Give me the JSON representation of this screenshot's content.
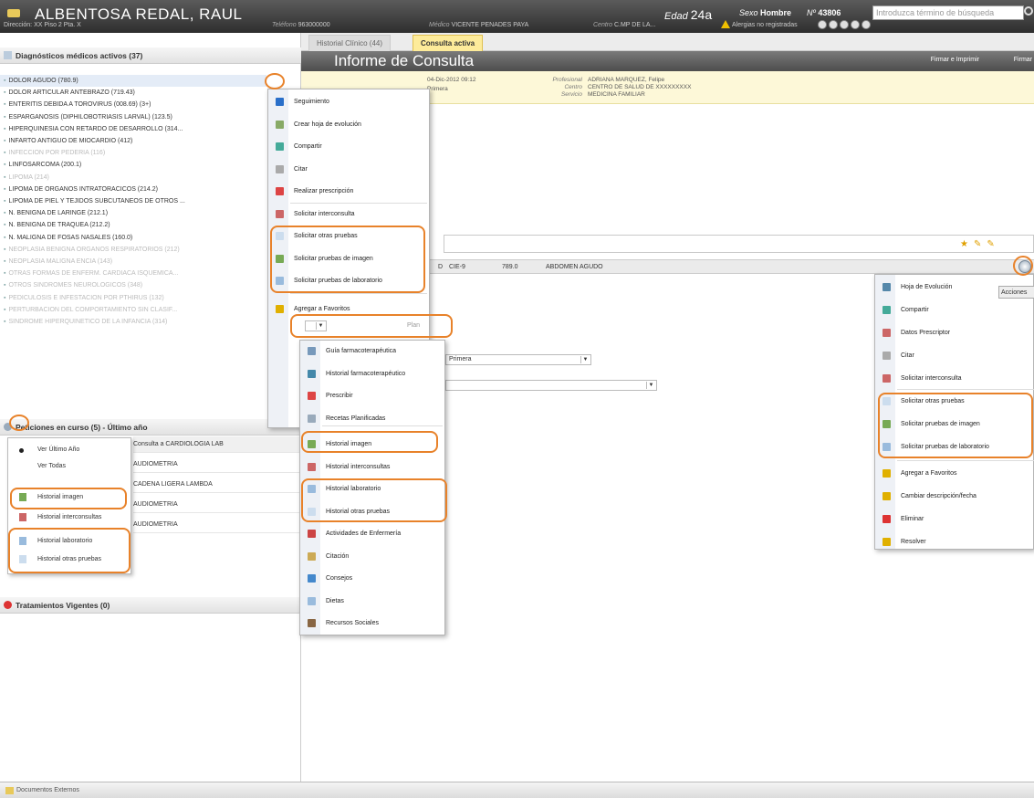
{
  "header": {
    "patient_name": "ALBENTOSA REDAL, RAUL",
    "edad_label": "Edad",
    "edad_value": "24a",
    "sexo_label": "Sexo",
    "sexo_value": "Hombre",
    "num_label": "Nº",
    "num_value": "43806",
    "search_placeholder": "Introduzca término de búsqueda",
    "direccion": "Dirección: XX Piso 2 Pta. X",
    "telefono_label": "Teléfono",
    "telefono_value": "963000000",
    "medico_label": "Médico",
    "medico_value": "VICENTE PENADES PAYA",
    "centro_label": "Centro",
    "centro_value": "C.MP DE LA...",
    "alergias": "Alergias no registradas"
  },
  "left": {
    "diag_header": "Diagnósticos médicos activos (37)",
    "diagnoses": [
      {
        "text": "DOLOR AGUDO (780.9)",
        "faded": false
      },
      {
        "text": "DOLOR ARTICULAR ANTEBRAZO (719.43)",
        "faded": false
      },
      {
        "text": "ENTERITIS DEBIDA A TOROVIRUS (008.69) (3+)",
        "faded": false
      },
      {
        "text": "ESPARGANOSIS (DIPHILOBOTRIASIS LARVAL) (123.5)",
        "faded": false
      },
      {
        "text": "HIPERQUINESIA CON RETARDO DE DESARROLLO (314...",
        "faded": false
      },
      {
        "text": "INFARTO ANTIGUO DE MIOCARDIO (412)",
        "faded": false
      },
      {
        "text": "INFECCION POR PEDERIA (116)",
        "faded": true
      },
      {
        "text": "LINFOSARCOMA (200.1)",
        "faded": false
      },
      {
        "text": "LIPOMA (214)",
        "faded": true
      },
      {
        "text": "LIPOMA DE ORGANOS INTRATORACICOS (214.2)",
        "faded": false
      },
      {
        "text": "LIPOMA DE PIEL Y TEJIDOS SUBCUTANEOS DE OTROS ...",
        "faded": false
      },
      {
        "text": "N. BENIGNA DE LARINGE (212.1)",
        "faded": false
      },
      {
        "text": "N. BENIGNA DE TRAQUEA (212.2)",
        "faded": false
      },
      {
        "text": "N. MALIGNA DE FOSAS NASALES (160.0)",
        "faded": false
      },
      {
        "text": "NEOPLASIA BENIGNA ORGANOS RESPIRATORIOS (212)",
        "faded": true
      },
      {
        "text": "NEOPLASIA MALIGNA ENCIA (143)",
        "faded": true
      },
      {
        "text": "OTRAS FORMAS DE ENFERM. CARDIACA ISQUEMICA...",
        "faded": true
      },
      {
        "text": "OTROS SINDROMES NEUROLOGICOS (348)",
        "faded": true
      },
      {
        "text": "PEDICULOSIS E INFESTACION POR PTHIRUS (132)",
        "faded": true
      },
      {
        "text": "PERTURBACION DEL COMPORTAMIENTO SIN CLASIF...",
        "faded": true
      },
      {
        "text": "SINDROME HIPERQUINETICO DE LA INFANCIA (314)",
        "faded": true
      }
    ],
    "peticiones_header": "Peticiones en curso (5) - Último año",
    "peticiones": [
      "Consulta a CARDIOLOGIA LAB",
      "AUDIOMETRIA",
      "CADENA LIGERA LAMBDA",
      "AUDIOMETRIA",
      "AUDIOMETRIA"
    ],
    "tratamientos_header": "Tratamientos Vigentes (0)",
    "popup": [
      "Ver Último Año",
      "Ver Todas",
      "Historial imagen",
      "Historial interconsultas",
      "Historial laboratorio",
      "Historial otras pruebas"
    ]
  },
  "main": {
    "tabs": [
      "Historial Clínico (44)",
      "Consulta activa"
    ],
    "title": "Informe de Consulta",
    "action_sign_print": "Firmar e Imprimir",
    "action_sign": "Firmar",
    "date": "04-Dic-2012 09:12",
    "tipo": "Primera",
    "profesional_label": "Profesional",
    "profesional_value": "ADRIANA MARQUEZ, Felipe",
    "centro_label": "Centro",
    "centro_value": "CENTRO DE SALUD DE XXXXXXXXX",
    "servicio_label": "Servicio",
    "servicio_value": "MEDICINA FAMILIAR",
    "cie_label": "CIE-9",
    "cie_code": "789.0",
    "cie_desc": "ABDOMEN AGUDO",
    "select1_value": "Primera",
    "plan_value": "Plan"
  },
  "menu_center": [
    "Seguimiento",
    "Crear hoja de evolución",
    "Compartir",
    "Citar",
    "Realizar prescripción",
    "Solicitar interconsulta",
    "Solicitar otras pruebas",
    "Solicitar pruebas de imagen",
    "Solicitar pruebas de laboratorio",
    "Agregar a Favoritos"
  ],
  "menu_sub": [
    "Guía farmacoterapéutica",
    "Historial farmacoterapéutico",
    "Prescribir",
    "Recetas Planificadas",
    "Historial imagen",
    "Historial interconsultas",
    "Historial laboratorio",
    "Historial otras pruebas",
    "Actividades de Enfermería",
    "Citación",
    "Consejos",
    "Dietas",
    "Recursos Sociales"
  ],
  "menu_right": [
    "Hoja de Evolución",
    "Compartir",
    "Datos Prescriptor",
    "Citar",
    "Solicitar interconsulta",
    "Solicitar otras pruebas",
    "Solicitar pruebas de imagen",
    "Solicitar pruebas de laboratorio",
    "Agregar a Favoritos",
    "Cambiar descripción/fecha",
    "Eliminar",
    "Resolver"
  ],
  "accion_label": "Acciones",
  "footer_label": "Documentos Externos",
  "colors": {
    "highlight": "#e8822a",
    "header": "#3d3d3d",
    "active_tab": "#fdeb9a",
    "infobox": "#fdf8d8"
  }
}
